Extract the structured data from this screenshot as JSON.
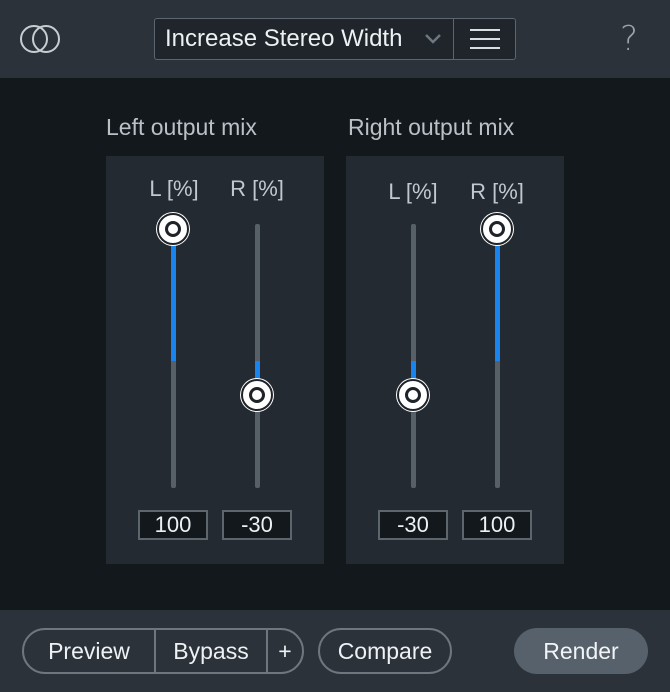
{
  "header": {
    "preset_name": "Increase Stereo Width",
    "help_label": "?"
  },
  "left_group": {
    "title": "Left output mix",
    "l_label": "L [%]",
    "r_label": "R [%]",
    "l_value": "100",
    "r_value": "-30",
    "l_level": 100,
    "r_level": -30
  },
  "right_group": {
    "title": "Right output mix",
    "l_label": "L [%]",
    "r_label": "R [%]",
    "l_value": "-30",
    "r_value": "100",
    "l_level": -30,
    "r_level": 100
  },
  "footer": {
    "preview_label": "Preview",
    "bypass_label": "Bypass",
    "plus_label": "+",
    "compare_label": "Compare",
    "render_label": "Render"
  },
  "colors": {
    "accent": "#1a84ee",
    "background": "#13181c",
    "panel": "#232a31"
  },
  "icons": [
    "stereo-rings-icon",
    "chevron-down-icon",
    "hamburger-menu-icon"
  ]
}
